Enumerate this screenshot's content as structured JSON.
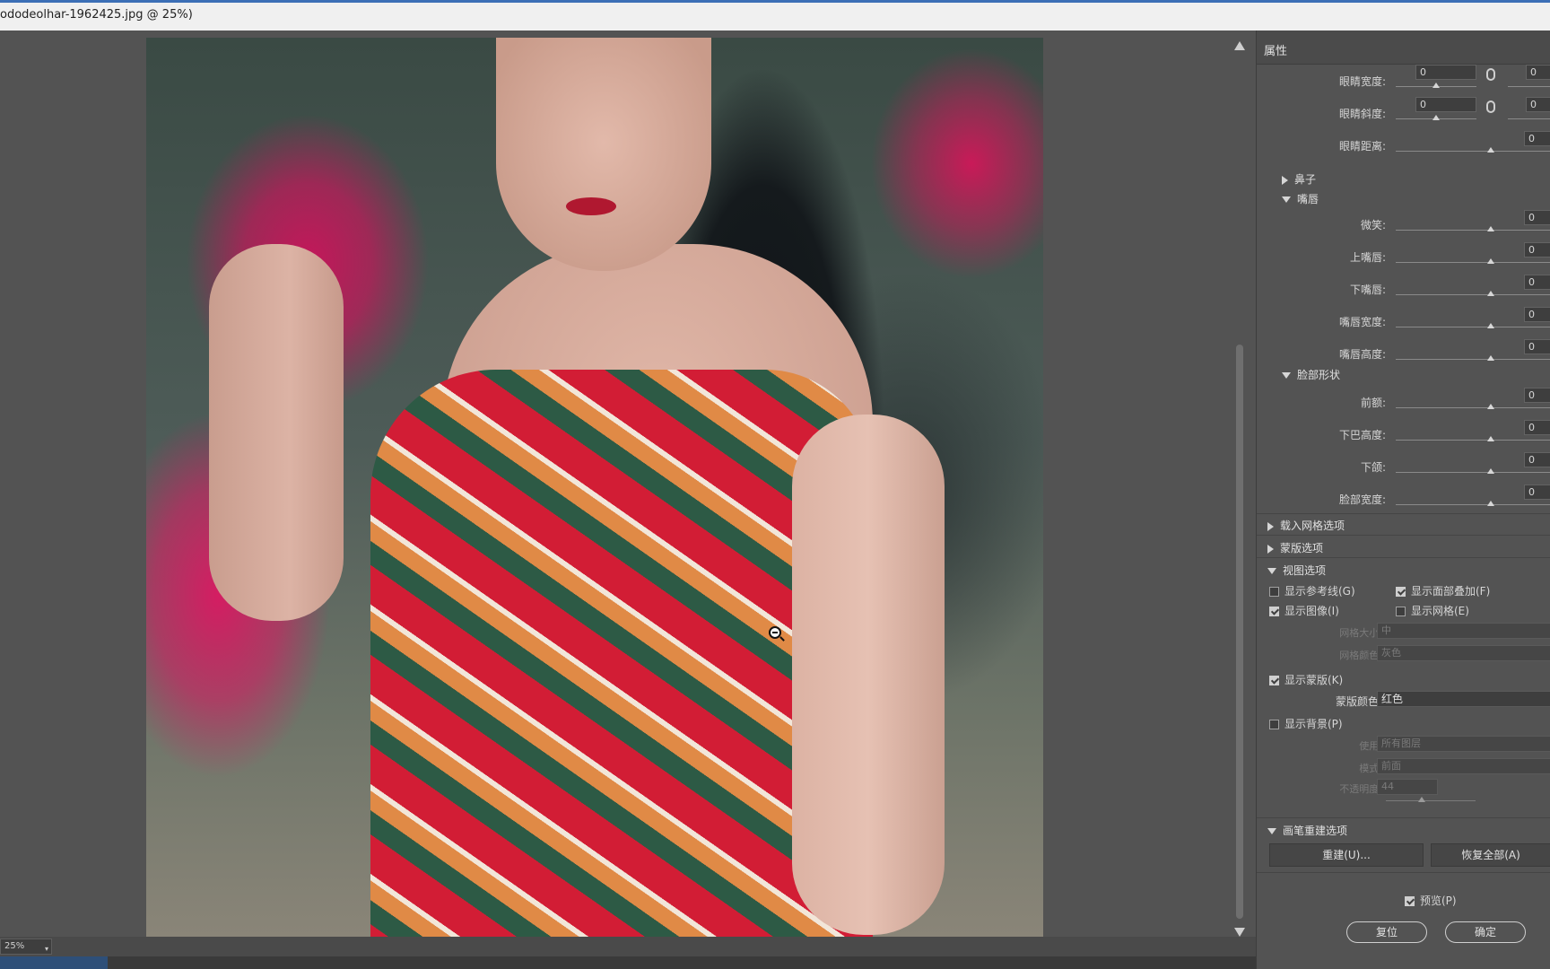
{
  "window": {
    "title": "ododeolhar-1962425.jpg @ 25%)"
  },
  "canvas": {
    "zoom": "25%"
  },
  "panel": {
    "title": "属性",
    "eyes": [
      {
        "label": "眼睛宽度:",
        "left_value": "0",
        "right_value": "0",
        "linked": true
      },
      {
        "label": "眼睛斜度:",
        "left_value": "0",
        "right_value": "0",
        "linked": true
      }
    ],
    "eye_distance": {
      "label": "眼睛距离:",
      "value": "0"
    },
    "nose_group": "鼻子",
    "mouth_group": "嘴唇",
    "mouth": [
      {
        "label": "微笑:",
        "value": "0"
      },
      {
        "label": "上嘴唇:",
        "value": "0"
      },
      {
        "label": "下嘴唇:",
        "value": "0"
      },
      {
        "label": "嘴唇宽度:",
        "value": "0"
      },
      {
        "label": "嘴唇高度:",
        "value": "0"
      }
    ],
    "face_group": "脸部形状",
    "face": [
      {
        "label": "前额:",
        "value": "0"
      },
      {
        "label": "下巴高度:",
        "value": "0"
      },
      {
        "label": "下颌:",
        "value": "0"
      },
      {
        "label": "脸部宽度:",
        "value": "0"
      }
    ],
    "sections": {
      "load_mesh": "载入网格选项",
      "mask": "蒙版选项",
      "view": "视图选项",
      "brush": "画笔重建选项"
    },
    "view_options": {
      "show_guides": {
        "label": "显示参考线(G)",
        "checked": false
      },
      "show_face_overlay": {
        "label": "显示面部叠加(F)",
        "checked": true
      },
      "show_image": {
        "label": "显示图像(I)",
        "checked": true
      },
      "show_mesh": {
        "label": "显示网格(E)",
        "checked": false
      },
      "mesh_size": {
        "label": "网格大小:",
        "value": "中"
      },
      "mesh_color": {
        "label": "网格颜色:",
        "value": "灰色"
      },
      "show_mask": {
        "label": "显示蒙版(K)",
        "checked": true
      },
      "mask_color": {
        "label": "蒙版颜色:",
        "value": "红色"
      },
      "show_backdrop": {
        "label": "显示背景(P)",
        "checked": false
      },
      "use": {
        "label": "使用:",
        "value": "所有图层"
      },
      "mode": {
        "label": "模式:",
        "value": "前面"
      },
      "opacity": {
        "label": "不透明度:",
        "value": "44"
      }
    },
    "brush_buttons": {
      "reconstruct": "重建(U)...",
      "restore_all": "恢复全部(A)"
    },
    "preview": {
      "label": "预览(P)",
      "checked": true
    },
    "reset_label": "复位",
    "ok_label": "确定"
  }
}
